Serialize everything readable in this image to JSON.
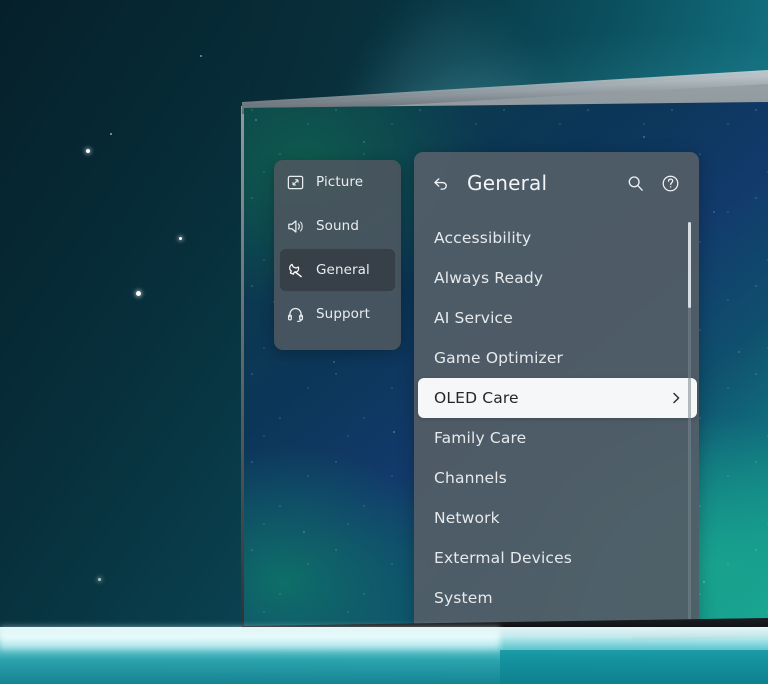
{
  "device": {
    "type": "television",
    "wallpaper": "starfield-space",
    "stand": "center-bar"
  },
  "sidebar": {
    "items": [
      {
        "label": "Picture",
        "icon": "picture-icon",
        "selected": false
      },
      {
        "label": "Sound",
        "icon": "speaker-icon",
        "selected": false
      },
      {
        "label": "General",
        "icon": "wrench-icon",
        "selected": true
      },
      {
        "label": "Support",
        "icon": "headset-icon",
        "selected": false
      }
    ]
  },
  "header": {
    "back_icon": "back-arrow-icon",
    "title": "General",
    "search_icon": "search-icon",
    "help_icon": "help-icon"
  },
  "menu": {
    "items": [
      {
        "label": "Accessibility",
        "active": false,
        "chevron": ""
      },
      {
        "label": "Always Ready",
        "active": false,
        "chevron": ""
      },
      {
        "label": "AI Service",
        "active": false,
        "chevron": ""
      },
      {
        "label": "Game Optimizer",
        "active": false,
        "chevron": ""
      },
      {
        "label": "OLED Care",
        "active": true,
        "chevron": "›"
      },
      {
        "label": "Family Care",
        "active": false,
        "chevron": ""
      },
      {
        "label": "Channels",
        "active": false,
        "chevron": ""
      },
      {
        "label": "Network",
        "active": false,
        "chevron": ""
      },
      {
        "label": "Extermal Devices",
        "active": false,
        "chevron": ""
      },
      {
        "label": "System",
        "active": false,
        "chevron": ""
      }
    ]
  },
  "scrollbar": {
    "name": "menu-scrollbar",
    "thumb_position_percent": 0
  },
  "colors": {
    "panel_bg": "#525e67",
    "sidebar_bg": "#4a565f",
    "selected_row_bg": "#f6f7f8",
    "selected_row_text": "#23282b",
    "text": "#e6eaec",
    "accent_room": "#2ea3ae"
  }
}
